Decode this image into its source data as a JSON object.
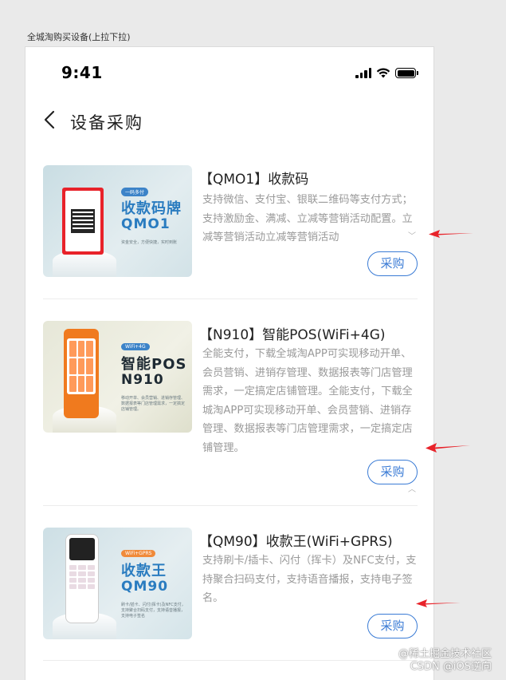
{
  "canvas_label": "全城淘购买设备(上拉下拉)",
  "status_bar": {
    "time": "9:41"
  },
  "nav": {
    "title": "设备采购"
  },
  "products": [
    {
      "title": "【QMO1】收款码",
      "description": "支持微信、支付宝、银联二维码等支付方式；支持激励金、满减、立减等营销活动配置。立减等营销活动立减等营销活动",
      "buy_label": "采购",
      "thumb": {
        "tag": "一码多付",
        "line1": "收款码牌",
        "line2": "QMO1",
        "sub": "资金安全，方便快捷，实时到账"
      }
    },
    {
      "title": "【N910】智能POS(WiFi+4G)",
      "description": "全能支付，下载全城淘APP可实现移动开单、会员营销、进销存管理、数据报表等门店管理需求，一定搞定店铺管理。全能支付，下载全城淘APP可实现移动开单、会员营销、进销存管理、数据报表等门店管理需求，一定搞定店铺管理。",
      "buy_label": "采购",
      "thumb": {
        "tag": "WiFi+4G",
        "line1": "智能POS",
        "line2": "N910",
        "sub": "移动开单、会员营销、进销存管理、数据报表等门店管理需求，一定搞定店铺管理。"
      }
    },
    {
      "title": "【QM90】收款王(WiFi+GPRS)",
      "description": "支持刷卡/插卡、闪付（挥卡）及NFC支付，支持聚合扫码支付，支持语音播报，支持电子签名。",
      "buy_label": "采购",
      "thumb": {
        "tag": "WiFi+GPRS",
        "line1": "收款王",
        "line2": "QM90",
        "sub": "刷卡/插卡、闪付(挥卡)及NFC支付，支持聚合扫码支付，支持语音播报，支持电子签名"
      }
    }
  ],
  "watermark": {
    "line1": "@稀土掘金技术社区",
    "line2": "CSDN @iOS逆向"
  },
  "colors": {
    "accent": "#3a7bd5",
    "arrow": "#e8232a",
    "desc_text": "#9a9a9a"
  }
}
